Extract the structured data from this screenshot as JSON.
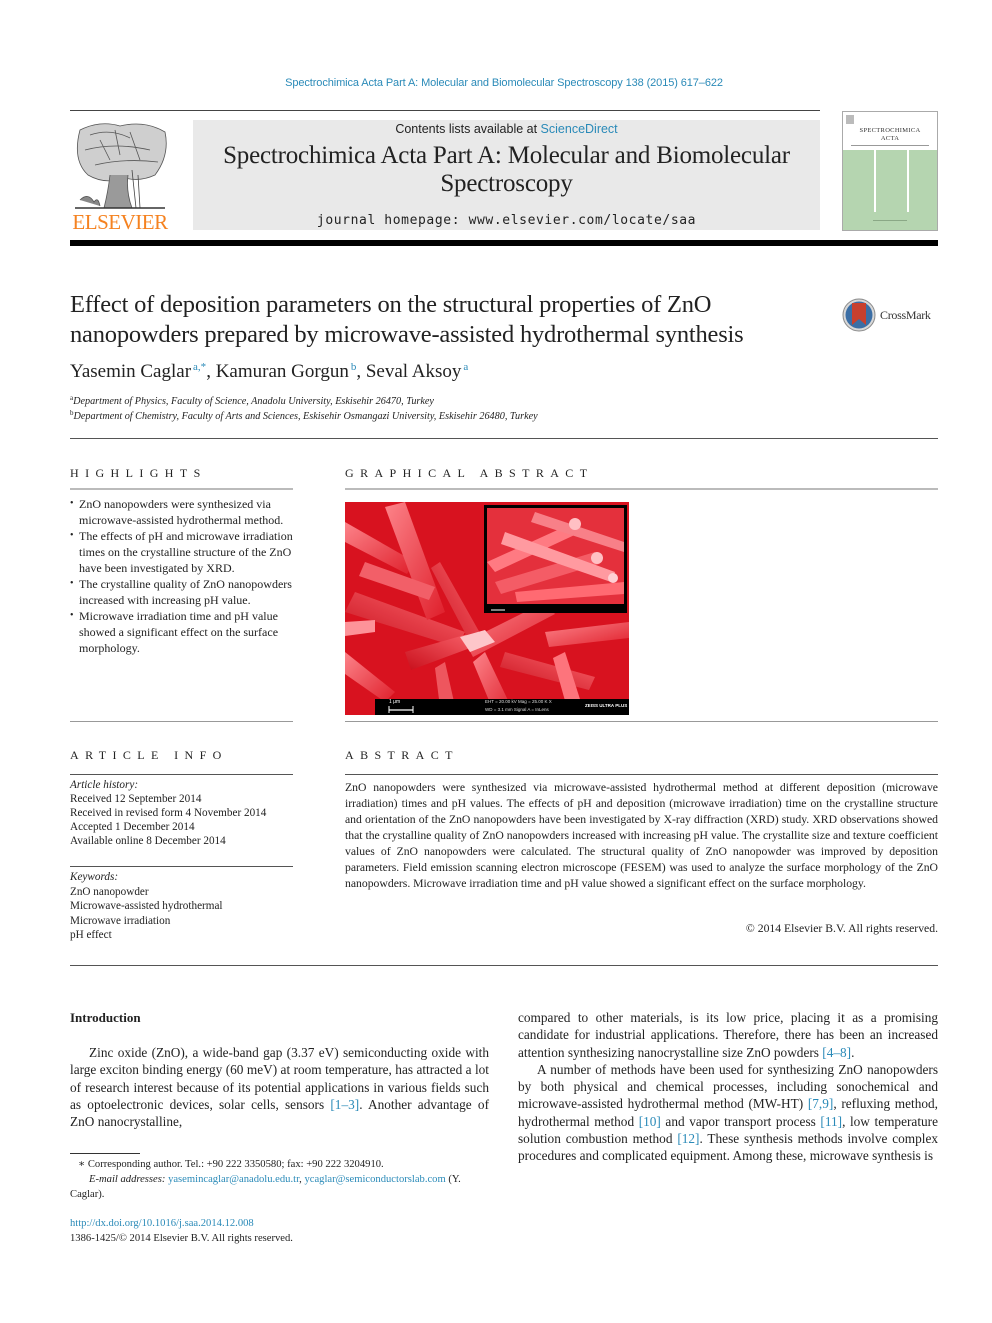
{
  "header": {
    "citation": "Spectrochimica Acta Part A: Molecular and Biomolecular Spectroscopy 138 (2015) 617–622",
    "contents_prefix": "Contents lists available at ",
    "contents_link": "ScienceDirect",
    "journal_title": "Spectrochimica Acta Part A: Molecular and Biomolecular Spectroscopy",
    "homepage_label": "journal homepage: ",
    "homepage_url": "www.elsevier.com/locate/saa",
    "publisher_logo": "ELSEVIER",
    "cover_title_line1": "SPECTROCHIMICA",
    "cover_title_line2": "ACTA",
    "colors": {
      "link": "#2a8ab8",
      "elsevier_orange": "#f58220",
      "cover_green": "#b5d5b0",
      "header_grey": "#e9e9e9"
    }
  },
  "article": {
    "title": "Effect of deposition parameters on the structural properties of ZnO nanopowders prepared by microwave-assisted hydrothermal synthesis",
    "crossmark_label": "CrossMark",
    "authors": [
      {
        "name": "Yasemin Caglar",
        "sup": "a,*"
      },
      {
        "name": "Kamuran Gorgun",
        "sup": "b"
      },
      {
        "name": "Seval Aksoy",
        "sup": "a"
      }
    ],
    "affiliations": [
      {
        "sup": "a",
        "text": "Department of Physics, Faculty of Science, Anadolu University, Eskisehir 26470, Turkey"
      },
      {
        "sup": "b",
        "text": "Department of Chemistry, Faculty of Arts and Sciences, Eskisehir Osmangazi University, Eskisehir 26480, Turkey"
      }
    ]
  },
  "highlights": {
    "heading": "HIGHLIGHTS",
    "items": [
      "ZnO nanopowders were synthesized via microwave-assisted hydrothermal method.",
      "The effects of pH and microwave irradiation times on the crystalline structure of the ZnO have been investigated by XRD.",
      "The crystalline quality of ZnO nanopowders increased with increasing pH value.",
      "Microwave irradiation time and pH value showed a significant effect on the surface morphology."
    ]
  },
  "graphical_abstract": {
    "heading": "GRAPHICAL ABSTRACT",
    "image_description": "false-color red FESEM micrograph of ZnO nanorod clusters with inset",
    "scale_bar": "1 μm",
    "inset_scale_bar": "200 nm",
    "sem_info_1": "EHT = 20.00 kV   Mag = 25.00 K X",
    "sem_info_2": "WD = 3.1 mm   Signal A = InLens",
    "sem_brand": "ZEISS ULTRA PLUS"
  },
  "article_info": {
    "heading": "ARTICLE INFO",
    "history_label": "Article history:",
    "history": [
      "Received 12 September 2014",
      "Received in revised form 4 November 2014",
      "Accepted 1 December 2014",
      "Available online 8 December 2014"
    ],
    "keywords_label": "Keywords:",
    "keywords": [
      "ZnO nanopowder",
      "Microwave-assisted hydrothermal",
      "Microwave irradiation",
      "pH effect"
    ]
  },
  "abstract": {
    "heading": "ABSTRACT",
    "text": "ZnO nanopowders were synthesized via microwave-assisted hydrothermal method at different deposition (microwave irradiation) times and pH values. The effects of pH and deposition (microwave irradiation) time on the crystalline structure and orientation of the ZnO nanopowders have been investigated by X-ray diffraction (XRD) study. XRD observations showed that the crystalline quality of ZnO nanopowders increased with increasing pH value. The crystallite size and texture coefficient values of ZnO nanopowders were calculated. The structural quality of ZnO nanopowder was improved by deposition parameters. Field emission scanning electron microscope (FESEM) was used to analyze the surface morphology of the ZnO nanopowders. Microwave irradiation time and pH value showed a significant effect on the surface morphology.",
    "copyright": "© 2014 Elsevier B.V. All rights reserved."
  },
  "body": {
    "intro_heading": "Introduction",
    "left_p1_a": "Zinc oxide (ZnO), a wide-band gap (3.37 eV) semiconducting oxide with large exciton binding energy (60 meV) at room temperature, has attracted a lot of research interest because of its potential applications in various fields such as optoelectronic devices, solar cells, sensors ",
    "ref_1_3": "[1–3]",
    "left_p1_b": ". Another advantage of ZnO nanocrystalline,",
    "right_p1_a": "compared to other materials, is its low price, placing it as a promising candidate for industrial applications. Therefore, there has been an increased attention synthesizing nanocrystalline size ZnO powders ",
    "ref_4_8": "[4–8]",
    "right_p1_b": ".",
    "right_p2_a": "A number of methods have been used for synthesizing ZnO nanopowders by both physical and chemical processes, including sonochemical and microwave-assisted hydrothermal method (MW-HT) ",
    "ref_7_9": "[7,9]",
    "right_p2_b": ", refluxing method, hydrothermal method ",
    "ref_10": "[10]",
    "right_p2_c": " and vapor transport process ",
    "ref_11": "[11]",
    "right_p2_d": ", low temperature solution combustion method ",
    "ref_12": "[12]",
    "right_p2_e": ". These synthesis methods involve complex procedures and complicated equipment. Among these, microwave synthesis is"
  },
  "footnotes": {
    "corresponding": "∗ Corresponding author. Tel.: +90 222 3350580; fax: +90 222 3204910.",
    "email_label": "E-mail addresses:",
    "email_1": "yasemincaglar@anadolu.edu.tr",
    "email_sep": ", ",
    "email_2": "ycaglar@semiconductorslab.com",
    "email_suffix": " (Y. Caglar).",
    "doi": "http://dx.doi.org/10.1016/j.saa.2014.12.008",
    "issn_copyright": "1386-1425/© 2014 Elsevier B.V. All rights reserved."
  }
}
